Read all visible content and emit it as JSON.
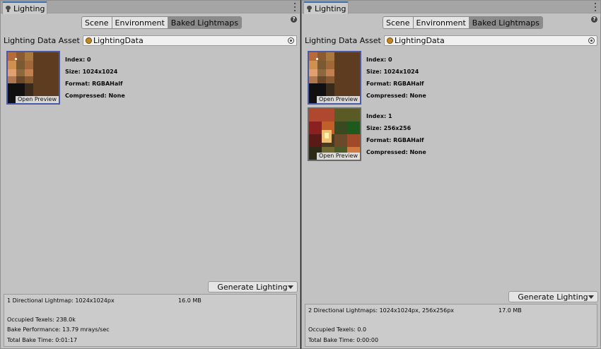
{
  "left": {
    "tab_title": "Lighting",
    "toolbar": [
      "Scene",
      "Environment",
      "Baked Lightmaps"
    ],
    "active_index": 2,
    "asset_label": "Lighting Data Asset",
    "asset_value": "LightingData",
    "lightmaps": [
      {
        "index": "Index: 0",
        "size": "Size: 1024x1024",
        "format": "Format: RGBAHalf",
        "compressed": "Compressed: None",
        "preview": "Open Preview"
      }
    ],
    "generate_label": "Generate Lighting",
    "stats": {
      "summary": "1 Directional Lightmap: 1024x1024px",
      "memory": "16.0 MB",
      "occupied": "Occupied Texels: 238.0k",
      "performance": "Bake Performance: 13.79 mrays/sec",
      "time": "Total Bake Time: 0:01:17"
    }
  },
  "right": {
    "tab_title": "Lighting",
    "toolbar": [
      "Scene",
      "Environment",
      "Baked Lightmaps"
    ],
    "active_index": 2,
    "asset_label": "Lighting Data Asset",
    "asset_value": "LightingData",
    "lightmaps": [
      {
        "index": "Index: 0",
        "size": "Size: 1024x1024",
        "format": "Format: RGBAHalf",
        "compressed": "Compressed: None",
        "preview": "Open Preview"
      },
      {
        "index": "Index: 1",
        "size": "Size: 256x256",
        "format": "Format: RGBAHalf",
        "compressed": "Compressed: None",
        "preview": "Open Preview"
      }
    ],
    "generate_label": "Generate Lighting",
    "stats": {
      "summary": "2 Directional Lightmaps: 1024x1024px, 256x256px",
      "memory": "17.0 MB",
      "occupied": "Occupied Texels: 0.0",
      "time": "Total Bake Time: 0:00:00"
    }
  },
  "icons": {
    "tab": "lightbulb-icon",
    "menu": "kebab-menu-icon",
    "help": "help-icon",
    "asset": "lighting-data-asset-icon",
    "picker": "object-picker-icon",
    "dropdown": "dropdown-arrow-icon"
  },
  "colors": {
    "panel_bg": "#c2c2c2",
    "active_tab": "#8b8b8b",
    "selected_border": "#4a5aa8",
    "tab_accent": "#3a72b0"
  }
}
